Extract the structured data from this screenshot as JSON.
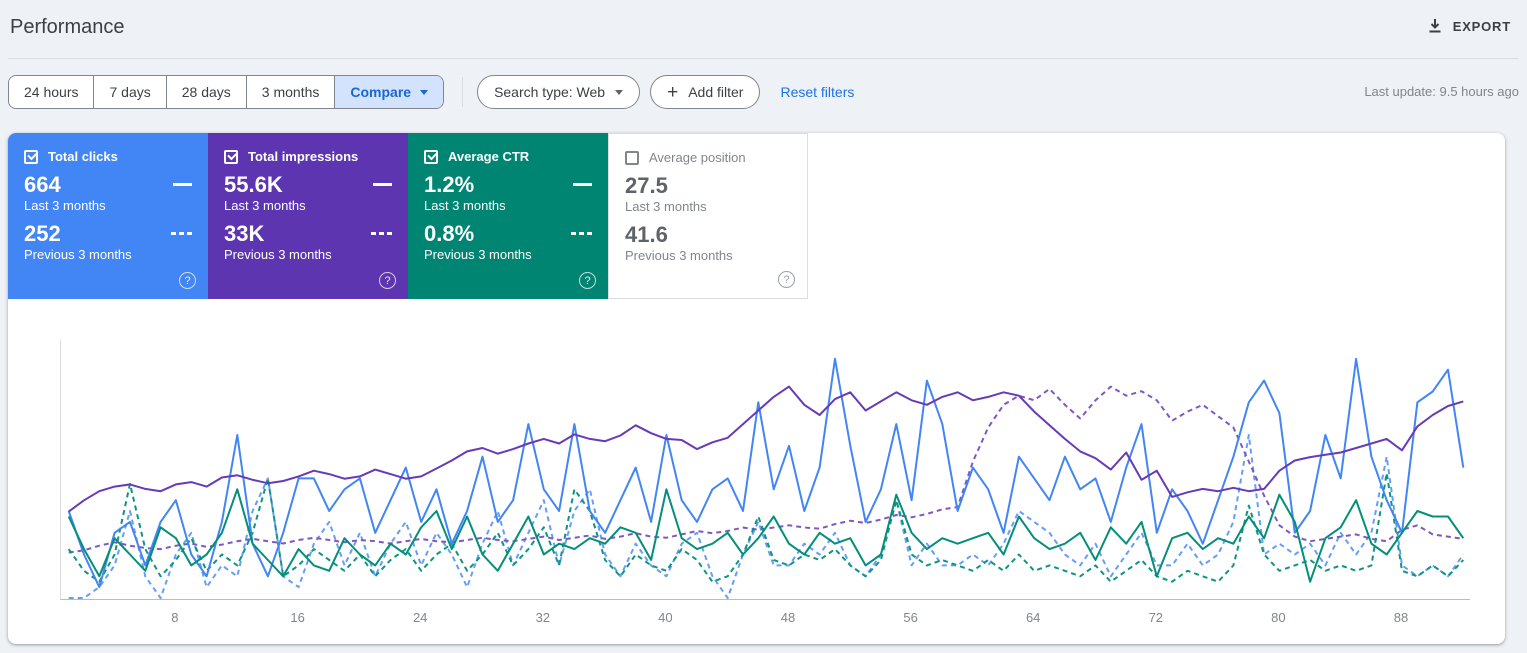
{
  "header": {
    "title": "Performance",
    "export_label": "EXPORT"
  },
  "filters": {
    "range_buttons": [
      {
        "label": "24 hours"
      },
      {
        "label": "7 days"
      },
      {
        "label": "28 days"
      },
      {
        "label": "3 months"
      }
    ],
    "compare_label": "Compare",
    "search_type_label": "Search type: Web",
    "add_filter_label": "Add filter",
    "reset_label": "Reset filters",
    "last_update": "Last update: 9.5 hours ago"
  },
  "cards": [
    {
      "label": "Total clicks",
      "checked": true,
      "color": "#4285f4",
      "value_current": "664",
      "period_current": "Last 3 months",
      "value_previous": "252",
      "period_previous": "Previous 3 months"
    },
    {
      "label": "Total impressions",
      "checked": true,
      "color": "#5e35b1",
      "value_current": "55.6K",
      "period_current": "Last 3 months",
      "value_previous": "33K",
      "period_previous": "Previous 3 months"
    },
    {
      "label": "Average CTR",
      "checked": true,
      "color": "#008573",
      "value_current": "1.2%",
      "period_current": "Last 3 months",
      "value_previous": "0.8%",
      "period_previous": "Previous 3 months"
    },
    {
      "label": "Average position",
      "checked": false,
      "color": "#ffffff",
      "value_current": "27.5",
      "period_current": "Last 3 months",
      "value_previous": "41.6",
      "period_previous": "Previous 3 months"
    }
  ],
  "chart_data": {
    "type": "line",
    "title": "Performance over time (daily, compare: last 3 months vs previous 3 months)",
    "xlabel": "",
    "ylabel": "",
    "x_range": [
      1,
      92
    ],
    "x_ticks": [
      8,
      16,
      24,
      32,
      40,
      48,
      56,
      64,
      72,
      80,
      88
    ],
    "grid": false,
    "legend_position": "cards-above",
    "series": [
      {
        "name": "Total clicks — Last 3 months",
        "style": "solid",
        "color": "#4285f4",
        "ymax": 23,
        "values": [
          8,
          4,
          1,
          6,
          7,
          3,
          7,
          9,
          4,
          2,
          7,
          15,
          5,
          2,
          6,
          11,
          11,
          8,
          10,
          11,
          6,
          9,
          12,
          7,
          10,
          5,
          8,
          13,
          7,
          9,
          16,
          10,
          8,
          16,
          8,
          6,
          9,
          12,
          7,
          15,
          9,
          7,
          10,
          11,
          8,
          18,
          10,
          14,
          8,
          12,
          22,
          14,
          7,
          10,
          16,
          9,
          20,
          16,
          8,
          12,
          10,
          6,
          13,
          11,
          9,
          13,
          10,
          11,
          7,
          12,
          16,
          6,
          10,
          8,
          5,
          9,
          13,
          18,
          20,
          17,
          6,
          8,
          15,
          11,
          22,
          13,
          9,
          6,
          18,
          19,
          21,
          12
        ]
      },
      {
        "name": "Total clicks — Previous 3 months",
        "style": "dashed",
        "color": "#669df6",
        "ymax": 23,
        "values": [
          0,
          0,
          1,
          3,
          8,
          2,
          0,
          4,
          6,
          1,
          3,
          2,
          8,
          11,
          2,
          1,
          5,
          7,
          3,
          6,
          2,
          5,
          7,
          3,
          6,
          4,
          1,
          5,
          8,
          3,
          6,
          9,
          3,
          8,
          10,
          4,
          2,
          5,
          3,
          2,
          5,
          6,
          2,
          0,
          4,
          7,
          3,
          3,
          5,
          4,
          6,
          3,
          2,
          4,
          9,
          3,
          5,
          3,
          3,
          4,
          3,
          5,
          8,
          7,
          6,
          4,
          3,
          5,
          2,
          4,
          6,
          3,
          3,
          5,
          3,
          4,
          7,
          15,
          4,
          5,
          4,
          5,
          3,
          6,
          4,
          6,
          13,
          3,
          2,
          3,
          2,
          4
        ]
      },
      {
        "name": "Total impressions — Last 3 months",
        "style": "solid",
        "color": "#673ab7",
        "ymax": 1100,
        "values": [
          380,
          430,
          470,
          490,
          500,
          480,
          470,
          500,
          510,
          490,
          530,
          540,
          520,
          505,
          515,
          535,
          560,
          545,
          525,
          535,
          565,
          545,
          525,
          535,
          570,
          605,
          645,
          660,
          635,
          655,
          680,
          700,
          680,
          720,
          700,
          690,
          715,
          760,
          725,
          700,
          695,
          655,
          685,
          705,
          765,
          825,
          885,
          930,
          850,
          805,
          875,
          905,
          825,
          865,
          905,
          870,
          850,
          885,
          905,
          870,
          885,
          905,
          890,
          820,
          760,
          700,
          645,
          615,
          565,
          640,
          520,
          560,
          445,
          465,
          480,
          470,
          485,
          470,
          480,
          560,
          605,
          620,
          630,
          640,
          660,
          680,
          700,
          650,
          755,
          805,
          845,
          865
        ]
      },
      {
        "name": "Total impressions — Previous 3 months",
        "style": "dashed",
        "color": "#7e57c2",
        "ymax": 1100,
        "values": [
          200,
          210,
          230,
          245,
          230,
          220,
          215,
          230,
          240,
          225,
          235,
          250,
          260,
          250,
          240,
          255,
          265,
          255,
          245,
          255,
          250,
          240,
          250,
          260,
          250,
          245,
          255,
          265,
          255,
          250,
          260,
          270,
          255,
          265,
          275,
          260,
          270,
          285,
          270,
          265,
          280,
          295,
          285,
          295,
          310,
          300,
          310,
          320,
          310,
          305,
          325,
          340,
          330,
          345,
          365,
          355,
          370,
          390,
          400,
          600,
          750,
          850,
          890,
          870,
          920,
          850,
          790,
          870,
          930,
          890,
          910,
          870,
          780,
          820,
          850,
          800,
          750,
          600,
          450,
          320,
          270,
          250,
          260,
          270,
          280,
          260,
          250,
          300,
          320,
          280,
          270,
          260
        ]
      },
      {
        "name": "Average CTR — Last 3 months",
        "style": "solid",
        "color": "#058e79",
        "ymax": 4.6,
        "values": [
          1.5,
          0.9,
          0.4,
          1.1,
          0.8,
          0.5,
          1.3,
          1.1,
          0.6,
          0.8,
          1.2,
          2.0,
          1.0,
          0.7,
          0.4,
          0.9,
          0.6,
          0.5,
          1.1,
          0.8,
          0.6,
          1.0,
          0.8,
          1.3,
          1.6,
          0.9,
          1.5,
          0.8,
          0.5,
          1.0,
          1.5,
          0.8,
          1.0,
          0.9,
          1.1,
          1.0,
          1.3,
          1.2,
          0.7,
          2.0,
          1.1,
          0.9,
          1.0,
          1.2,
          0.8,
          1.1,
          1.5,
          1.0,
          0.8,
          1.2,
          1.0,
          1.1,
          0.6,
          0.8,
          1.9,
          1.2,
          0.9,
          1.1,
          1.0,
          1.1,
          1.2,
          0.8,
          1.5,
          1.1,
          0.9,
          1.0,
          1.2,
          0.7,
          1.3,
          1.0,
          1.4,
          0.4,
          1.1,
          1.2,
          0.9,
          1.1,
          1.0,
          1.5,
          1.1,
          1.9,
          1.4,
          0.3,
          1.1,
          1.3,
          1.8,
          1.0,
          0.8,
          1.2,
          1.6,
          1.5,
          1.5,
          1.1
        ]
      },
      {
        "name": "Average CTR — Previous 3 months",
        "style": "dashed",
        "color": "#0d9584",
        "ymax": 4.6,
        "values": [
          0.9,
          0.5,
          0.3,
          0.8,
          2.1,
          0.9,
          0.4,
          0.7,
          1.1,
          0.5,
          0.8,
          0.6,
          1.2,
          2.2,
          0.4,
          0.6,
          0.9,
          0.7,
          0.5,
          0.8,
          0.4,
          0.7,
          0.9,
          0.5,
          0.8,
          1.0,
          0.5,
          0.8,
          1.2,
          0.6,
          0.9,
          1.3,
          0.6,
          2.0,
          1.6,
          0.7,
          0.4,
          0.8,
          0.6,
          0.5,
          0.9,
          0.7,
          0.3,
          0.4,
          0.8,
          1.5,
          0.7,
          0.6,
          0.8,
          0.7,
          0.9,
          0.6,
          0.4,
          0.7,
          1.8,
          0.8,
          0.6,
          0.7,
          0.6,
          0.5,
          0.7,
          0.5,
          0.8,
          0.5,
          0.6,
          0.5,
          0.4,
          0.6,
          0.3,
          0.5,
          0.7,
          0.4,
          0.3,
          0.5,
          0.4,
          0.3,
          0.6,
          1.7,
          0.8,
          0.5,
          0.6,
          0.7,
          0.5,
          0.6,
          0.5,
          0.6,
          2.3,
          0.5,
          0.4,
          0.6,
          0.4,
          0.7
        ]
      }
    ]
  }
}
